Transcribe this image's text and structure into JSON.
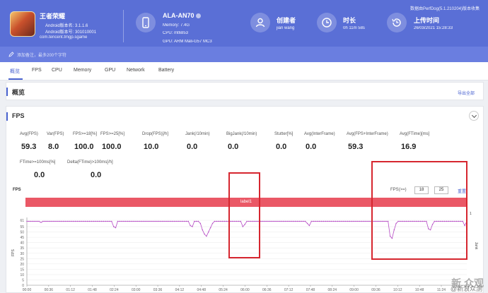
{
  "app": {
    "name": "王者荣耀",
    "android_version_label": "Android版本名: 3.1.1.6",
    "android_code_label": "Android版本号: 301010001",
    "package": "com.tencent.tmgp.sgame"
  },
  "device": {
    "name": "ALA-AN70",
    "memory": "Memory: 7.4G",
    "cpu": "CPU: mt6853",
    "gpu": "GPU: ARM Mali-G57 MC3"
  },
  "creator": {
    "label": "创建者",
    "value": "jian wang"
  },
  "duration": {
    "label": "时长",
    "value": "0h 11m 58s"
  },
  "upload": {
    "label": "上传时间",
    "value": "26/03/2021 15:28:33"
  },
  "perfdog_version": "数据由PerfDog(5.1.210204)版本收集",
  "note_placeholder": "添加备注，最多200个字符",
  "tabs": [
    "概览",
    "FPS",
    "CPU",
    "Memory",
    "GPU",
    "Network",
    "Battery"
  ],
  "overview": {
    "title": "概览",
    "export": "导出全部"
  },
  "fps_panel": {
    "title": "FPS"
  },
  "metrics_row1": [
    {
      "label": "Avg(FPS)",
      "value": "59.3"
    },
    {
      "label": "Var(FPS)",
      "value": "8.0"
    },
    {
      "label": "FPS>=18[%]",
      "value": "100.0"
    },
    {
      "label": "FPS>=25[%]",
      "value": "100.0"
    },
    {
      "label": "Drop(FPS)[/h]",
      "value": "10.0"
    },
    {
      "label": "Jank(/10min)",
      "value": "0.0"
    },
    {
      "label": "BigJank(/10min)",
      "value": "0.0"
    },
    {
      "label": "Stutter[%]",
      "value": "0.0"
    },
    {
      "label": "Avg(InterFrame)",
      "value": "0.0"
    },
    {
      "label": "Avg(FPS+InterFrame)",
      "value": "59.3"
    },
    {
      "label": "Avg(FTime)[ms]",
      "value": "16.9"
    }
  ],
  "metrics_row2": [
    {
      "label": "FTime>=100ms[%]",
      "value": "0.0"
    },
    {
      "label": "Delta(FTime)>100ms[/h]",
      "value": "0.0"
    }
  ],
  "chart_controls": {
    "threshold_label": "FPS(>=)",
    "threshold_1": "18",
    "threshold_2": "25",
    "reset": "重置",
    "label_text": "label1"
  },
  "watermark": {
    "big": "新 众观",
    "small": "@新浪众测"
  },
  "chart_data": {
    "type": "line",
    "title": "",
    "ylabel": "FPS",
    "y_right_label": "Jank",
    "right_axis_value": "1",
    "ylim": [
      0,
      61
    ],
    "y_ticks": [
      "61",
      "55",
      "50",
      "45",
      "40",
      "35",
      "30",
      "25",
      "20",
      "15",
      "10",
      "5",
      "0"
    ],
    "x_ticks": [
      "00:00",
      "00:36",
      "01:12",
      "01:48",
      "02:24",
      "03:00",
      "03:36",
      "04:12",
      "04:48",
      "05:24",
      "06:00",
      "06:36",
      "07:12",
      "07:48",
      "08:24",
      "09:00",
      "09:36",
      "10:12",
      "10:48",
      "11:24"
    ],
    "series": [
      {
        "values": [
          60,
          60,
          60,
          60,
          60,
          60,
          60,
          59,
          60,
          60,
          60,
          60,
          60,
          60,
          60,
          60,
          60,
          60,
          60,
          60,
          60,
          60,
          60,
          60,
          60,
          60,
          60,
          60,
          60,
          60,
          60,
          60,
          60,
          60,
          60,
          60,
          60,
          60,
          60,
          60,
          60,
          60,
          60,
          55,
          54,
          60,
          60,
          60,
          60,
          60,
          60,
          60,
          60,
          60,
          60,
          60,
          60,
          60,
          60,
          60,
          60,
          60,
          60,
          60,
          60,
          60,
          60,
          60,
          60,
          60,
          60,
          60,
          60,
          60,
          60,
          60,
          60,
          60,
          60,
          60,
          60,
          56,
          55,
          60,
          60,
          60,
          58,
          52,
          48,
          46,
          50,
          54,
          58,
          60,
          60,
          60,
          60,
          60,
          60,
          60,
          60,
          60,
          60,
          60,
          60,
          60,
          60,
          55,
          57,
          60,
          60,
          60,
          60,
          60,
          60,
          60,
          60,
          60,
          60,
          60,
          60,
          60,
          60,
          60,
          60,
          60,
          60,
          60,
          60,
          60,
          60,
          60,
          60,
          60,
          60,
          60,
          60,
          60,
          60,
          58,
          56,
          60,
          60,
          60,
          60,
          60,
          60,
          60,
          60,
          60,
          60,
          60,
          60,
          60,
          60,
          60,
          60,
          60,
          60,
          60,
          60,
          60,
          60,
          60,
          60,
          60,
          60,
          60,
          60,
          60,
          60,
          60,
          60,
          60,
          60,
          60,
          60,
          60,
          60,
          60,
          46,
          44,
          52,
          58,
          60,
          60,
          60,
          60,
          60,
          60,
          60,
          60,
          60,
          60,
          60,
          60,
          60,
          60,
          60,
          53,
          52,
          57,
          60,
          60,
          60,
          60,
          60,
          60,
          60,
          60,
          60,
          60,
          60,
          60,
          60,
          60,
          60,
          56,
          60
        ]
      }
    ]
  }
}
